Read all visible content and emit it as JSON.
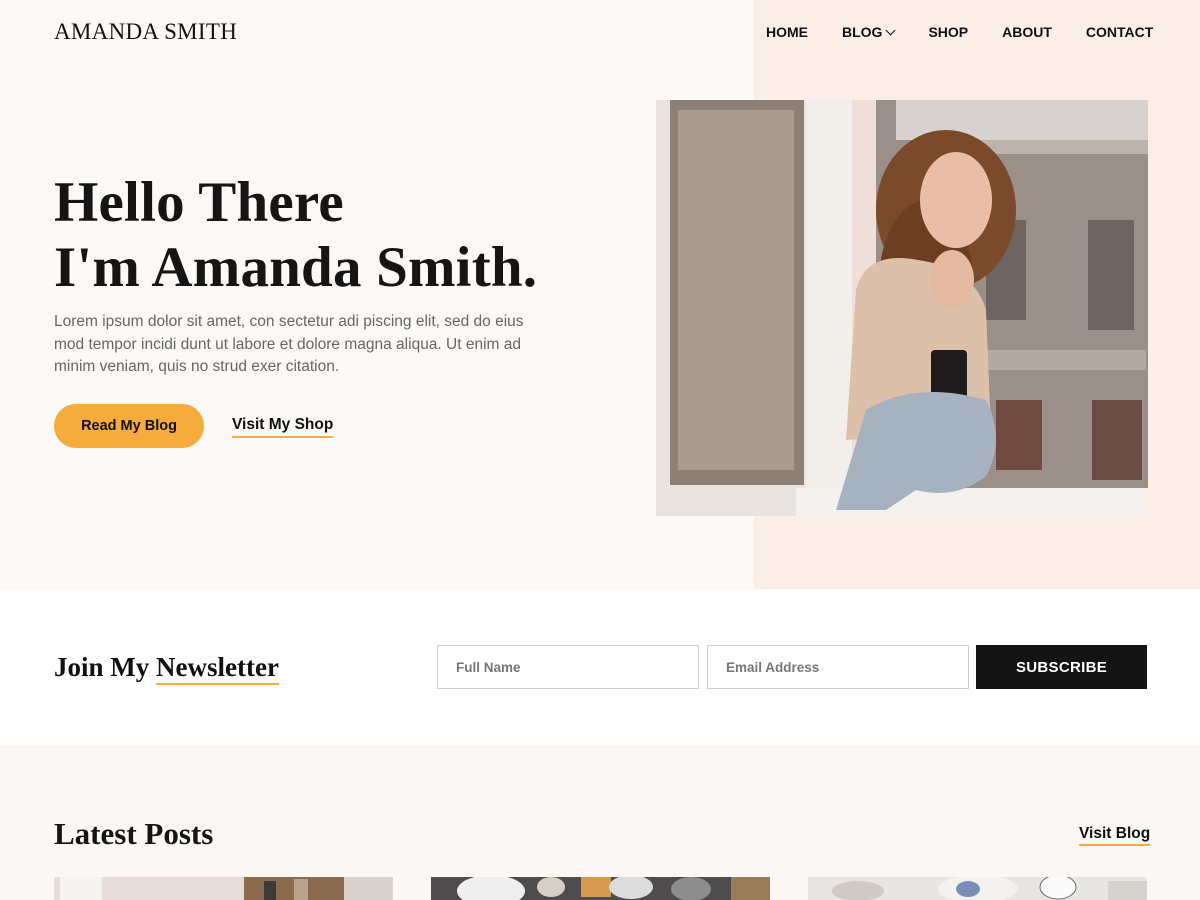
{
  "site": {
    "title": "AMANDA SMITH"
  },
  "nav": {
    "items": [
      "HOME",
      "BLOG",
      "SHOP",
      "ABOUT",
      "CONTACT"
    ]
  },
  "hero": {
    "heading_line1": "Hello There",
    "heading_line2": "I'm Amanda Smith.",
    "text": "Lorem ipsum dolor sit amet, con sectetur adi piscing elit, sed do eius mod tempor incidi dunt ut labore et dolore magna aliqua. Ut enim ad minim veniam, quis no strud exer citation.",
    "primary_button": "Read My Blog",
    "secondary_link": "Visit My Shop"
  },
  "newsletter": {
    "title_part1": "Join My ",
    "title_part2": "Newsletter",
    "name_placeholder": "Full Name",
    "email_placeholder": "Email Address",
    "subscribe_label": "SUBSCRIBE"
  },
  "latest": {
    "title": "Latest Posts",
    "visit_link": "Visit Blog"
  },
  "colors": {
    "accent": "#f5ac3a",
    "hero_bg": "#fdf9f7",
    "hero_right_bg": "#fbeee7",
    "button_dark": "#131313"
  }
}
